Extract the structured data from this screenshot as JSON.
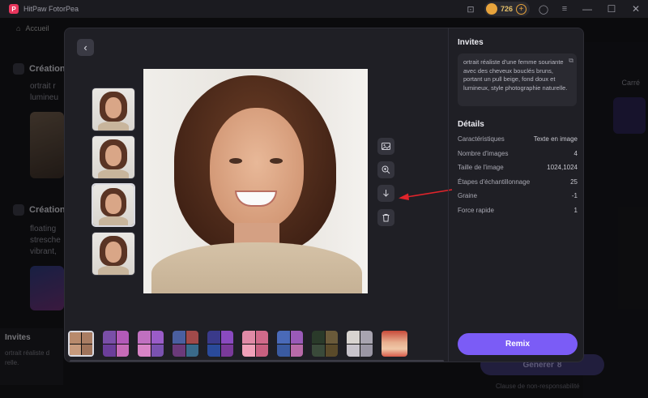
{
  "app": {
    "title": "HitPaw FotorPea",
    "credits": "726"
  },
  "breadcrumb": {
    "label": "Accueil"
  },
  "background": {
    "section1_title": "Création",
    "section1_text": "ortrait r\nlumineu",
    "section2_title": "Création",
    "section2_text": "floating\nstresche\nvibrant,",
    "side_label": "Carré",
    "side_generate": "Générer",
    "invites_title": "Invites",
    "invites_text": "ortrait réaliste d\nrelle.",
    "generate_button": "Générer",
    "generate_cost": "8",
    "disclaimer": "Clause de non-responsabilité"
  },
  "modal": {
    "invites_title": "Invites",
    "prompt": "ortrait réaliste d'une femme souriante avec des cheveux bouclés bruns, portant un pull beige, fond doux et lumineux, style photographie naturelle.",
    "details_title": "Détails",
    "details": [
      {
        "label": "Caractéristiques",
        "value": "Texte en image"
      },
      {
        "label": "Nombre d'images",
        "value": "4"
      },
      {
        "label": "Taille de l'image",
        "value": "1024,1024"
      },
      {
        "label": "Étapes d'échantillonnage",
        "value": "25"
      },
      {
        "label": "Graine",
        "value": "-1"
      },
      {
        "label": "Force rapide",
        "value": "1"
      }
    ],
    "remix_label": "Remix",
    "tools": [
      "image-icon",
      "zoom-in-icon",
      "download-icon",
      "delete-icon"
    ]
  },
  "colors": {
    "accent": "#7b5cf6",
    "arrow": "#e0242b",
    "panel": "#1f1f25"
  }
}
